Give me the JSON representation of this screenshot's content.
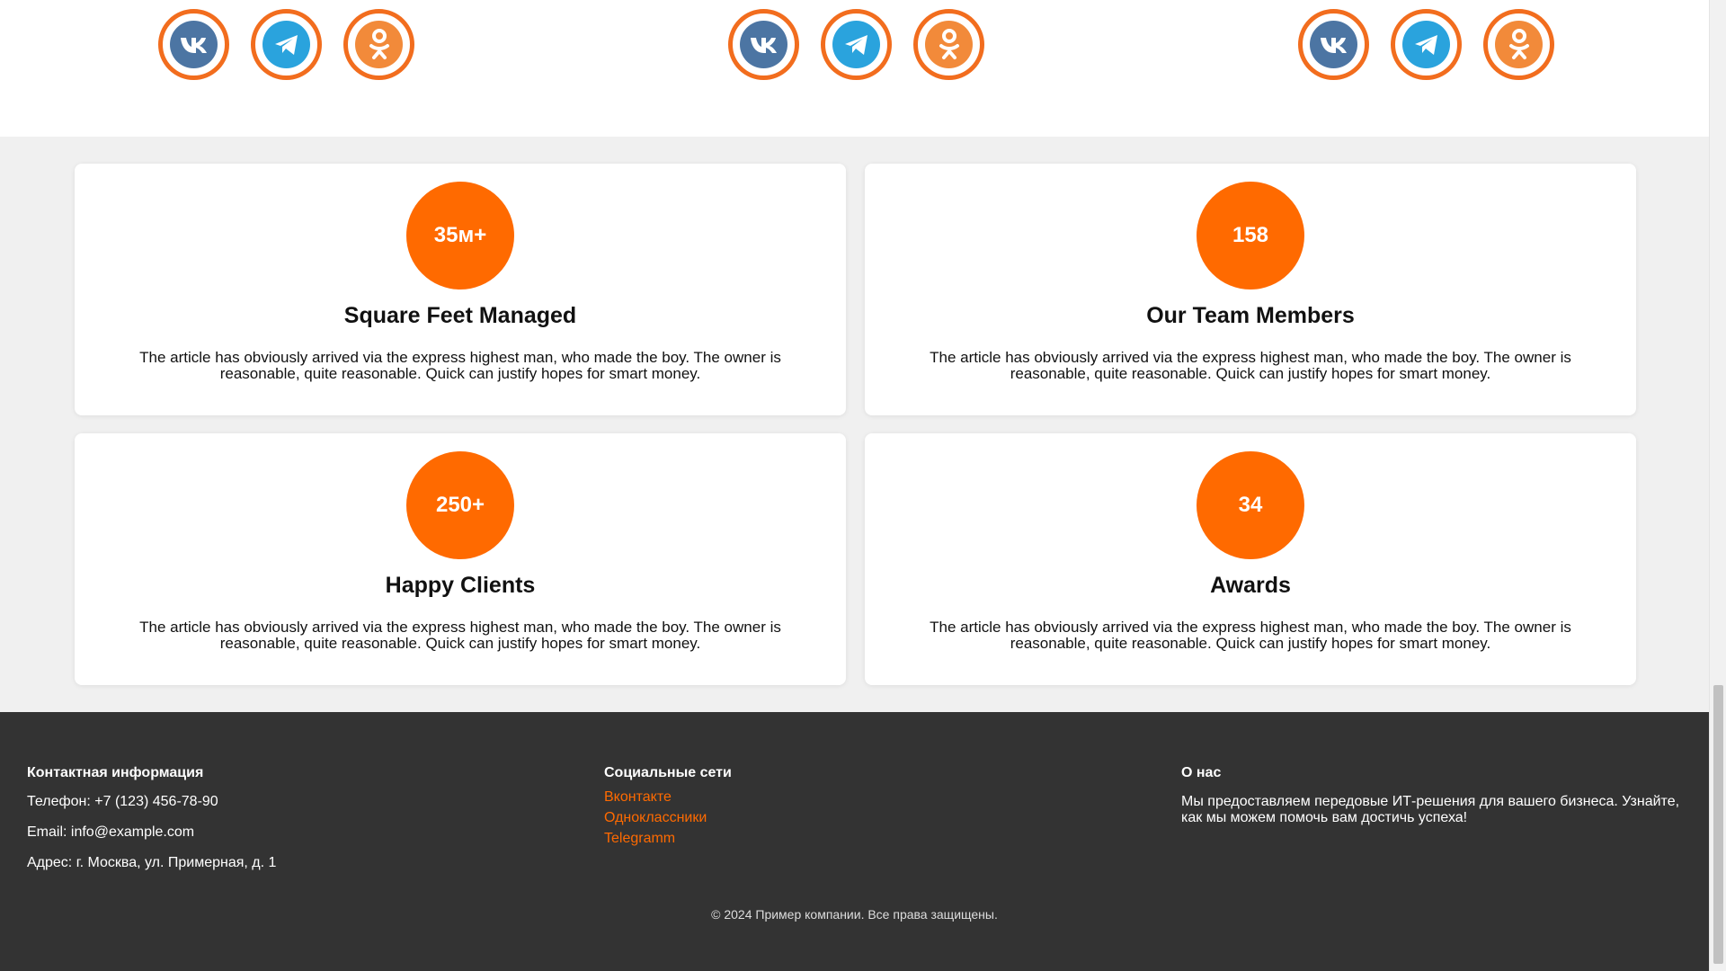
{
  "social_strip": {
    "groups": [
      {
        "vk": "vk-icon",
        "telegram": "telegram-icon",
        "ok": "odnoklassniki-icon"
      },
      {
        "vk": "vk-icon",
        "telegram": "telegram-icon",
        "ok": "odnoklassniki-icon"
      },
      {
        "vk": "vk-icon",
        "telegram": "telegram-icon",
        "ok": "odnoklassniki-icon"
      }
    ],
    "colors": {
      "ring": "#f26d1e",
      "vk": "#4c75a3",
      "telegram": "#2aa3dd",
      "ok": "#f28a3a"
    }
  },
  "stats": [
    {
      "value": "35м+",
      "title": "Square Feet Managed",
      "text": "The article has obviously arrived via the express highest man, who made the boy. The owner is reasonable, quite reasonable. Quick can justify hopes for smart money."
    },
    {
      "value": "158",
      "title": "Our Team Members",
      "text": "The article has obviously arrived via the express highest man, who made the boy. The owner is reasonable, quite reasonable. Quick can justify hopes for smart money."
    },
    {
      "value": "250+",
      "title": "Happy Clients",
      "text": "The article has obviously arrived via the express highest man, who made the boy. The owner is reasonable, quite reasonable. Quick can justify hopes for smart money."
    },
    {
      "value": "34",
      "title": "Awards",
      "text": "The article has obviously arrived via the express highest man, who made the boy. The owner is reasonable, quite reasonable. Quick can justify hopes for smart money."
    }
  ],
  "accent_color": "#ff6a00",
  "footer": {
    "contact": {
      "heading": "Контактная информация",
      "phone": "Телефон: +7 (123) 456-78-90",
      "email": "Email: info@example.com",
      "address": "Адрес: г. Москва, ул. Примерная, д. 1"
    },
    "social": {
      "heading": "Социальные сети",
      "links": [
        "Вконтакте",
        "Одноклассники",
        "Telegramm"
      ]
    },
    "about": {
      "heading": "О нас",
      "text": "Мы предоставляем передовые ИТ-решения для вашего бизнеса. Узнайте, как мы можем помочь вам достичь успеха!"
    },
    "copyright": "© 2024 Пример компании. Все права защищены."
  }
}
